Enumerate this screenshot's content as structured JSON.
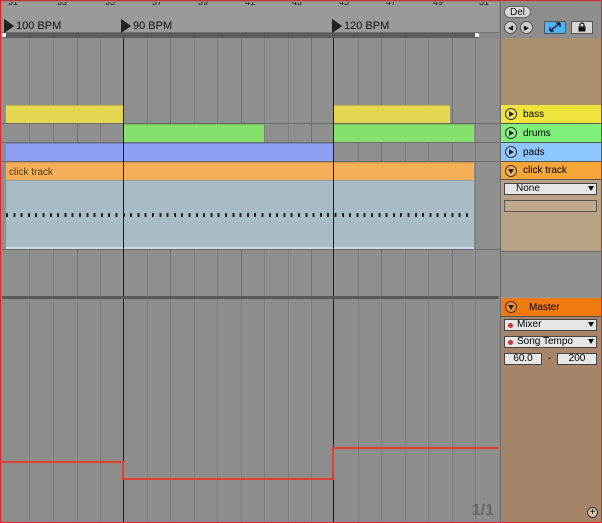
{
  "ruler": {
    "ticks": [
      "31",
      "33",
      "35",
      "37",
      "39",
      "41",
      "43",
      "45",
      "47",
      "49",
      "51"
    ]
  },
  "tempo_markers": [
    {
      "label": "100 BPM"
    },
    {
      "label": "90 BPM"
    },
    {
      "label": "120 BPM"
    }
  ],
  "tracks": {
    "bass": {
      "name": "bass",
      "color": "#f0e43c",
      "clip_color": "#e4d650"
    },
    "drums": {
      "name": "drums",
      "color": "#7ef07a",
      "clip_color": "#86e06c"
    },
    "pads": {
      "name": "pads",
      "color": "#8ec6ff",
      "clip_color": "#8e9ef0"
    },
    "click": {
      "name": "click track",
      "clip_label": "click track",
      "color": "#f7a63a",
      "clip_color": "#f5ae58",
      "input_value": "None"
    }
  },
  "controls": {
    "delete_label": "Del",
    "prev_label": "◀",
    "next_label": "▶"
  },
  "master": {
    "name": "Master",
    "color": "#f07a10",
    "device": "Mixer",
    "parameter": "Song Tempo",
    "range_min": "60.0",
    "range_sep": "-",
    "range_max": "200"
  },
  "pager": "1/1",
  "colors": {
    "automation": "#e04030",
    "master_panel": "#a5846a",
    "track_panel": "#a88f6f"
  }
}
